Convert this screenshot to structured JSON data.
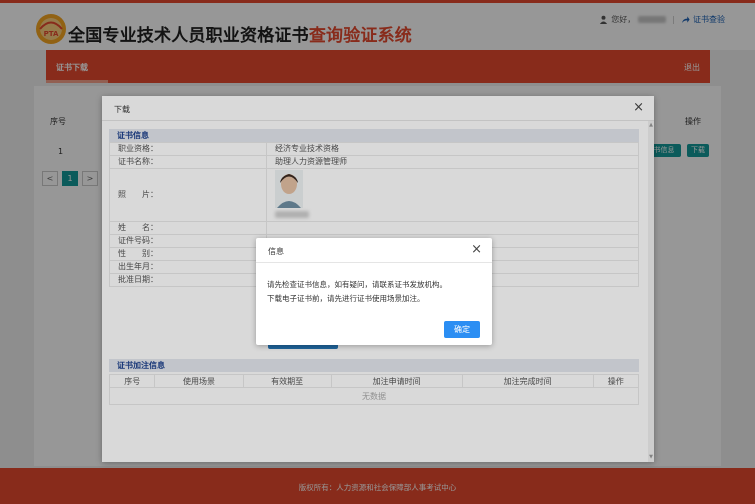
{
  "header": {
    "title_main": "全国专业技术人员职业资格证书",
    "title_highlight": "查询验证系统",
    "logo_text": "PTA",
    "greeting": "您好，",
    "verify_link": "证书查验"
  },
  "nav": {
    "tab": "证书下载",
    "logout": "退出"
  },
  "table": {
    "col_index": "序号",
    "col_ops": "操作",
    "rows": [
      {
        "index": "1",
        "btn_info": "书信息",
        "btn_download": "下载"
      }
    ]
  },
  "pager": {
    "prev": "<",
    "current": "1",
    "next": ">"
  },
  "footer": "版权所有：人力资源和社会保障部人事考试中心",
  "download_dialog": {
    "title": "下载",
    "section_cert": "证书信息",
    "fields": [
      {
        "label": "职业资格：",
        "value": "经济专业技术资格"
      },
      {
        "label": "证书名称：",
        "value": "助理人力资源管理师"
      },
      {
        "label": "照　　片：",
        "value": ""
      },
      {
        "label": "姓　　名：",
        "value": ""
      },
      {
        "label": "证件号码：",
        "value": ""
      },
      {
        "label": "性　　别：",
        "value": ""
      },
      {
        "label": "出生年月：",
        "value": ""
      },
      {
        "label": "批准日期：",
        "value": ""
      }
    ],
    "section_addon": "证书加注信息",
    "addon_headers": [
      "序号",
      "使用场景",
      "有效期至",
      "加注申请时间",
      "加注完成时间",
      "操作"
    ],
    "addon_empty": "无数据"
  },
  "alert": {
    "title": "信息",
    "line1": "请先检查证书信息，如有疑问，请联系证书发放机构。",
    "line2": "下载电子证书前，请先进行证书使用场景加注。",
    "ok": "确定"
  },
  "colors": {
    "brand_red": "#e64a2e",
    "teal": "#149a9a",
    "ok_blue": "#2b8ef3"
  }
}
